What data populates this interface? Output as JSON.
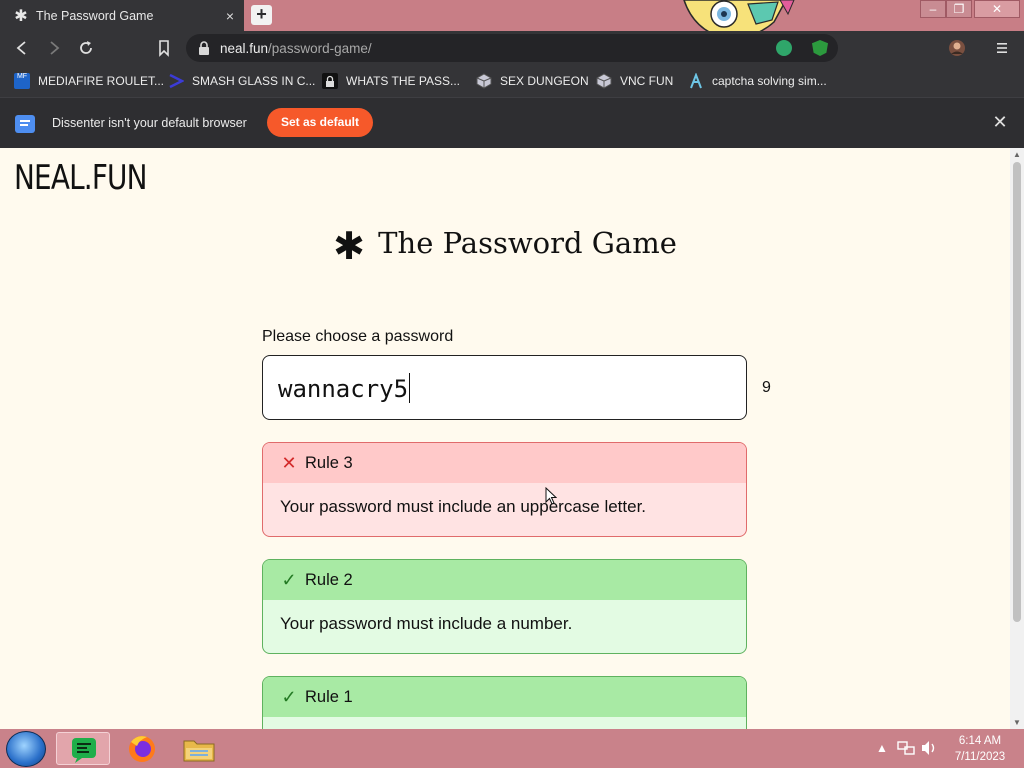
{
  "browser": {
    "tab": {
      "title": "The Password Game",
      "close_icon": "×"
    },
    "new_tab_label": "+",
    "window_controls": {
      "minimize": "–",
      "maximize": "❐",
      "close": "✕"
    },
    "address": {
      "host": "neal.fun",
      "path": "/password-game/"
    },
    "bookmarks": [
      {
        "label": "MEDIAFIRE ROULET...",
        "icon": "mediafire-icon",
        "icon_text": "MF",
        "color": "#1e64c8"
      },
      {
        "label": "SMASH GLASS IN C...",
        "icon": "chevron-icon",
        "icon_text": "",
        "color": "#3b3bd6"
      },
      {
        "label": "WHATS THE PASS...",
        "icon": "lock-icon",
        "icon_text": "",
        "color": "#111111"
      },
      {
        "label": "SEX DUNGEON",
        "icon": "cube-icon",
        "icon_text": "",
        "color": "#8a8aa0"
      },
      {
        "label": "VNC FUN",
        "icon": "cube-icon",
        "icon_text": "",
        "color": "#8a8aa0"
      },
      {
        "label": "captcha solving sim...",
        "icon": "lambda-icon",
        "icon_text": "",
        "color": "#6ec6e6"
      }
    ],
    "infobar": {
      "message": "Dissenter isn't your default browser",
      "button": "Set as default",
      "close": "✕"
    }
  },
  "page": {
    "logo": "NEAL.FUN",
    "title": "The Password Game",
    "title_star": "✱",
    "prompt": "Please choose a password",
    "password": "wannacry5",
    "char_count": "9",
    "rules": [
      {
        "status": "fail",
        "icon": "cross-icon",
        "symbol": "✕",
        "name": "Rule 3",
        "text": "Your password must include an uppercase letter."
      },
      {
        "status": "pass",
        "icon": "check-icon",
        "symbol": "✓",
        "name": "Rule 2",
        "text": "Your password must include a number."
      },
      {
        "status": "pass",
        "icon": "check-icon",
        "symbol": "✓",
        "name": "Rule 1",
        "text": ""
      }
    ]
  },
  "taskbar": {
    "clock_time": "6:14 AM",
    "clock_date": "7/11/2023"
  },
  "colors": {
    "page_bg": "#fffaee",
    "fail_border": "#e06b6b",
    "pass_border": "#5fb25f",
    "accent_orange": "#f6592a"
  }
}
